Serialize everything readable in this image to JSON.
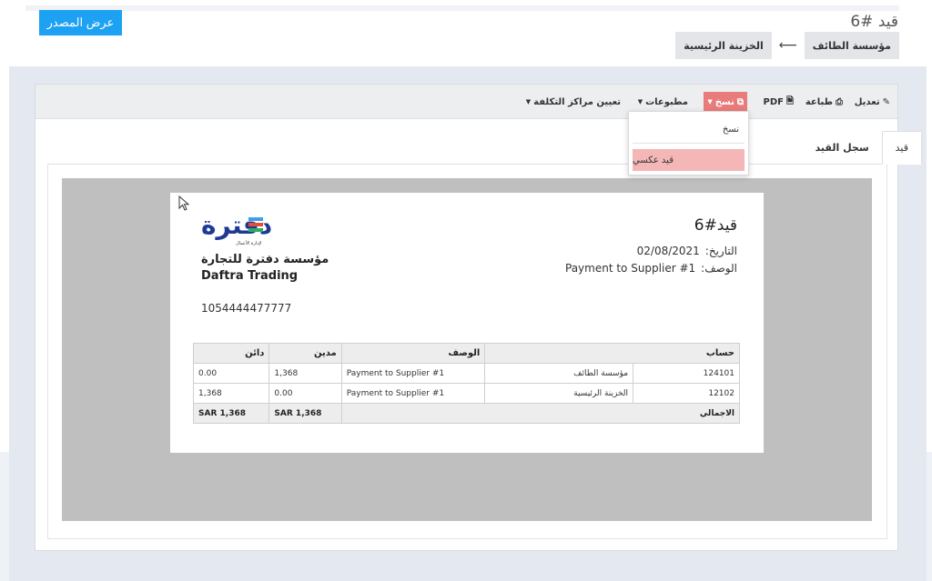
{
  "header": {
    "source_button": "عرض المصدر",
    "page_title": "قيد #6",
    "breadcrumb": {
      "current": "مؤسسة الطائف",
      "arrow": "⟵",
      "link": "الخزينة الرئيسية"
    }
  },
  "toolbar": {
    "edit": "تعديل",
    "print": "طباعة",
    "pdf": "PDF",
    "copy": "نسخ",
    "printables": "مطبوعات",
    "cost_centers": "تعيين مراكز التكلفة"
  },
  "copy_menu": {
    "items": [
      "نسخ",
      "قيد عكسي"
    ]
  },
  "tabs": [
    {
      "label": "قيد",
      "active": true
    },
    {
      "label": "سجل القيد",
      "active": false
    }
  ],
  "document": {
    "logo_text": "دفترة",
    "logo_tagline": "لإدارة الأعمال",
    "company_ar": "مؤسسة دفترة للتجارة",
    "company_en": "Daftra Trading",
    "tax_number": "1054444477777",
    "title": "قيد#6",
    "date_label": "التاريخ:",
    "date_value": "02/08/2021",
    "desc_label": "الوصف:",
    "desc_value": "Payment to Supplier #1",
    "table": {
      "headers": {
        "account": "حساب",
        "description": "الوصف",
        "debit": "مدين",
        "credit": "دائن"
      },
      "rows": [
        {
          "code": "124101",
          "name": "مؤسسة الطائف",
          "description": "Payment to Supplier #1",
          "debit": "1,368",
          "credit": "0.00"
        },
        {
          "code": "12102",
          "name": "الخزينة الرئيسية",
          "description": "Payment to Supplier #1",
          "debit": "0.00",
          "credit": "1,368"
        }
      ],
      "total": {
        "label": "الاجمالي",
        "debit": "SAR 1,368",
        "credit": "SAR 1,368"
      }
    }
  },
  "colors": {
    "source_button": "#1da1f2",
    "copy_active": "#e87c7c",
    "menu_highlight": "#f4b6b6",
    "logo_blue": "#1f3a93"
  }
}
